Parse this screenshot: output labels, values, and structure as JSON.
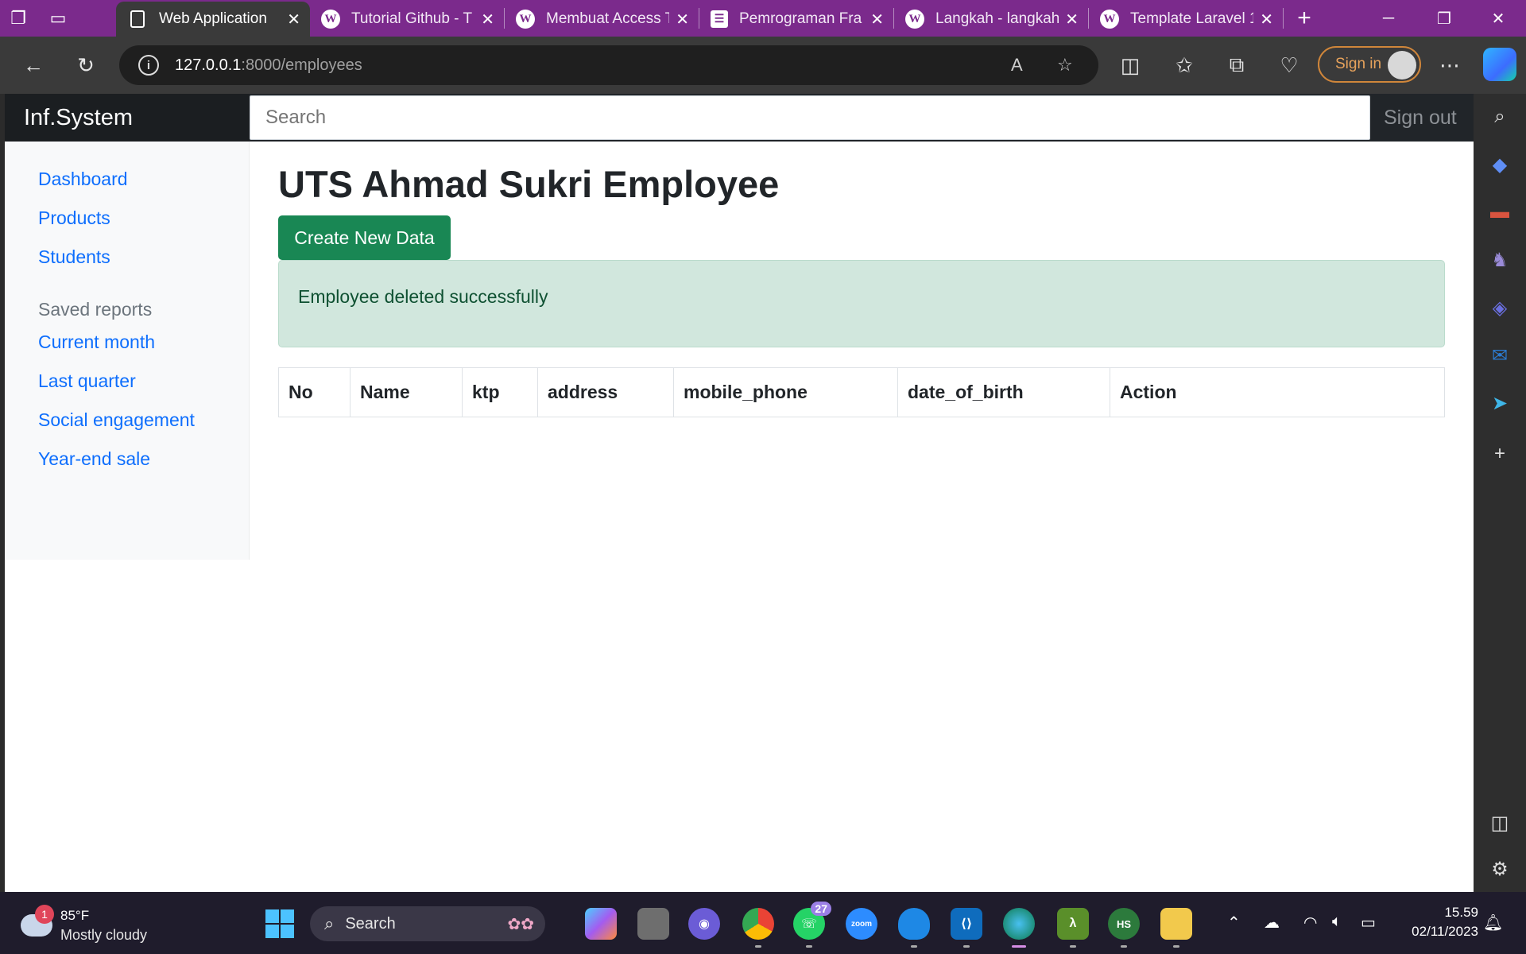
{
  "browser": {
    "tabs": [
      {
        "title": "Web Application",
        "active": true
      },
      {
        "title": "Tutorial Github - T",
        "active": false
      },
      {
        "title": "Membuat Access T",
        "active": false
      },
      {
        "title": "Pemrograman Fra",
        "active": false
      },
      {
        "title": "Langkah - langkah",
        "active": false
      },
      {
        "title": "Template Laravel 1",
        "active": false
      }
    ],
    "url_host": "127.0.0.1",
    "url_path": ":8000/employees",
    "signin_label": "Sign in"
  },
  "app": {
    "brand": "Inf.System",
    "search_placeholder": "Search",
    "signout": "Sign out",
    "sidebar": {
      "main_links": [
        "Dashboard",
        "Products",
        "Students"
      ],
      "saved_heading": "Saved reports",
      "saved_links": [
        "Current month",
        "Last quarter",
        "Social engagement",
        "Year-end sale"
      ]
    },
    "page_title": "UTS Ahmad Sukri Employee",
    "create_button": "Create New Data",
    "alert": "Employee deleted successfully",
    "table_headers": [
      "No",
      "Name",
      "ktp",
      "address",
      "mobile_phone",
      "date_of_birth",
      "Action"
    ]
  },
  "taskbar": {
    "weather_badge": "1",
    "temperature": "85°F",
    "condition": "Mostly cloudy",
    "search_label": "Search",
    "whatsapp_badge": "27",
    "time": "15.59",
    "date": "02/11/2023"
  },
  "colors": {
    "tab_strip": "#7b2a8c",
    "navbar": "#212529",
    "link": "#0d6efd",
    "success": "#198754",
    "alert_bg": "#d1e7dd"
  }
}
